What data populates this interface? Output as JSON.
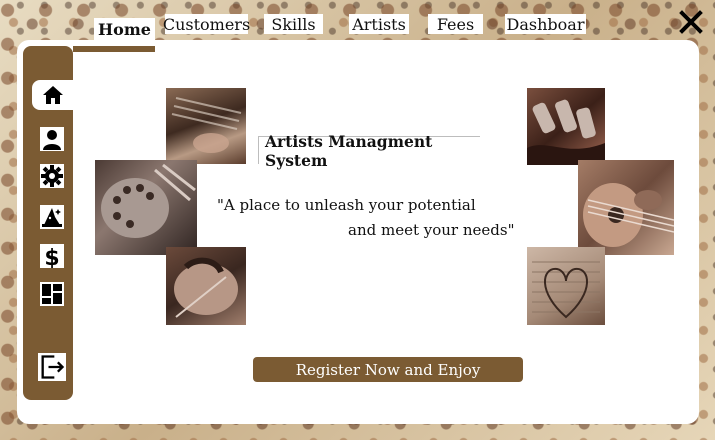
{
  "nav": {
    "tabs": [
      {
        "label": "Home"
      },
      {
        "label": "Customers"
      },
      {
        "label": "Skills"
      },
      {
        "label": "Artists"
      },
      {
        "label": "Fees"
      },
      {
        "label": "Dashboar"
      }
    ]
  },
  "sidebar": {
    "items": [
      {
        "icon": "home-icon"
      },
      {
        "icon": "user-icon"
      },
      {
        "icon": "gear-icon"
      },
      {
        "icon": "wizard-hat-icon"
      },
      {
        "icon": "dollar-icon"
      },
      {
        "icon": "dashboard-icon"
      },
      {
        "icon": "logout-icon"
      }
    ]
  },
  "main": {
    "title": "Artists Managment System",
    "quote_line1": "\"A place to unleash your potential",
    "quote_line2": "and meet your needs\"",
    "register_label": "Register Now and Enjoy"
  },
  "colors": {
    "accent": "#7b5b33",
    "panel": "#ffffff"
  }
}
